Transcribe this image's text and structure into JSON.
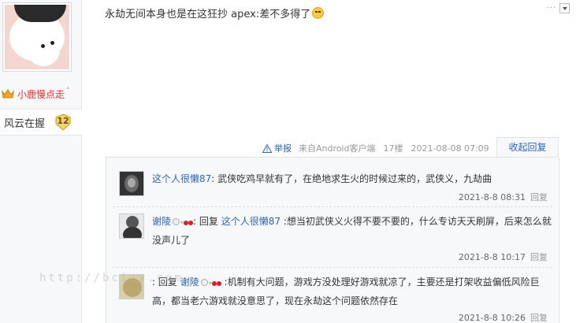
{
  "user": {
    "name": "小鹿慢点走",
    "gender_mark": "°",
    "level_name": "风云在握",
    "level": "12"
  },
  "post": {
    "text": "永劫无间本身也是在这狂抄 apex:差不多得了",
    "meta": {
      "report": "举报",
      "source": "来自Android客户端",
      "floor": "17楼",
      "time": "2021-08-08 07:09"
    },
    "fold_reply": "收起回复",
    "top_right_dots": "···"
  },
  "comments": [
    {
      "user": "这个人很懒87",
      "content": ": 武侠吃鸡早就有了，在绝地求生火的时候过来的，武侠义，九劫曲",
      "time": "2021-8-8 08:31",
      "reply_label": "回复"
    },
    {
      "user": "谢陵",
      "reply_prefix": ": 回复 ",
      "reply_to": "这个人很懒87",
      "content": " :想当初武侠义火得不要不要的，什么专访天天刷屏，后来怎么就没声儿了",
      "time": "2021-8-8 10:17",
      "reply_label": "回复"
    },
    {
      "user": "",
      "reply_prefix": ": 回复 ",
      "reply_to": "谢陵",
      "content": " :机制有大问题，游戏方没处理好游戏就凉了，主要还是打架收益偏低风险巨高，都当老六游戏就没意思了，现在永劫这个问题依然存在",
      "time": "2021-8-8 10:26",
      "reply_label": "回复"
    }
  ],
  "watermark": "http://bcizy.com",
  "colors": {
    "link": "#2d64b3",
    "username_red": "#f22d33",
    "panel_bg": "#f7f8fa"
  }
}
